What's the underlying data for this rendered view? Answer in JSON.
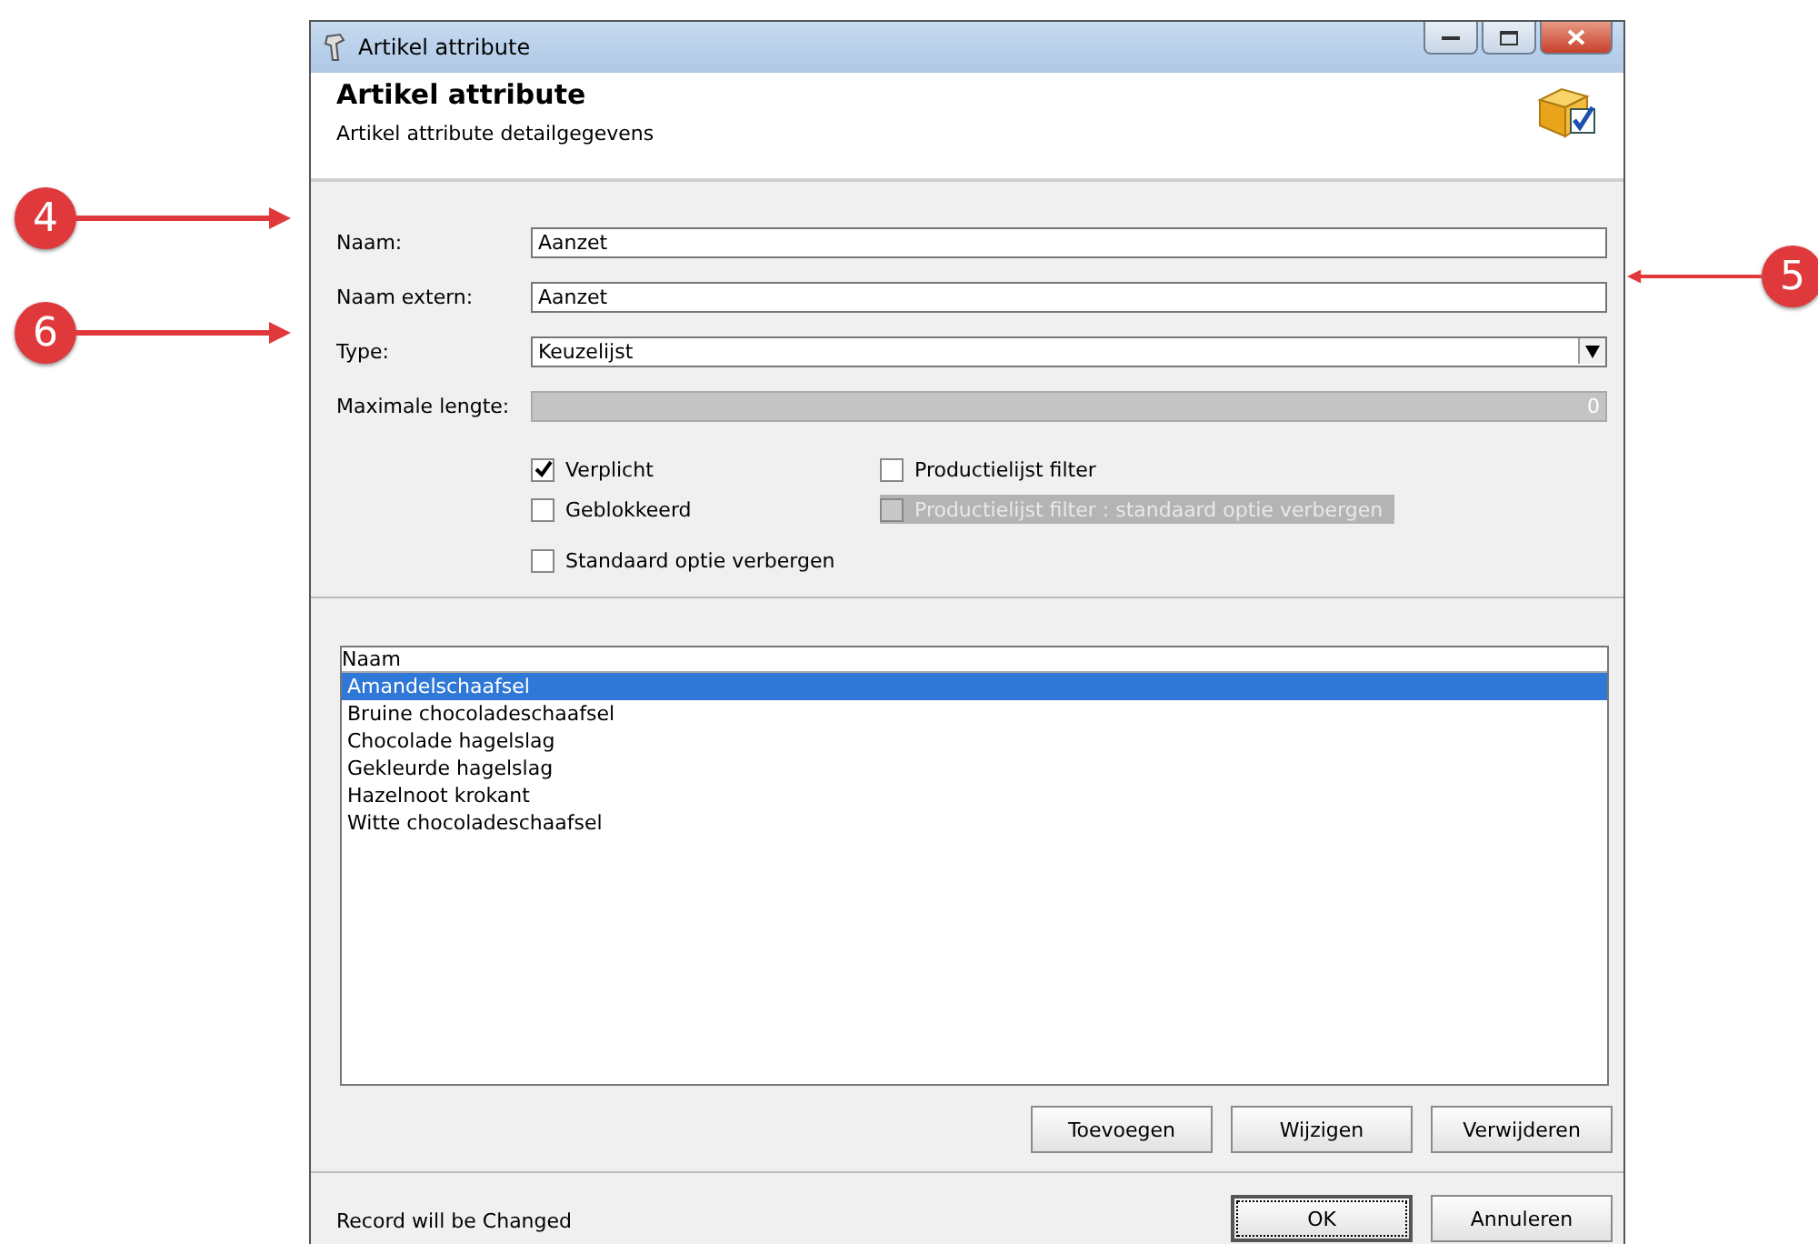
{
  "window": {
    "title": "Artikel attribute"
  },
  "header": {
    "title": "Artikel attribute",
    "subtitle": "Artikel attribute detailgegevens"
  },
  "fields": [
    {
      "kind": "text",
      "label": "Naam:",
      "value": "Aanzet",
      "disabled": false
    },
    {
      "kind": "text",
      "label": "Naam extern:",
      "value": "Aanzet",
      "disabled": false
    },
    {
      "kind": "select",
      "label": "Type:",
      "value": "Keuzelijst",
      "disabled": false
    },
    {
      "kind": "number",
      "label": "Maximale lengte:",
      "value": "0",
      "disabled": true
    }
  ],
  "checkbox_columns": [
    [
      {
        "label": "Verplicht",
        "checked": true,
        "disabled": false
      },
      {
        "label": "Geblokkeerd",
        "checked": false,
        "disabled": false
      },
      {
        "label": "Standaard optie verbergen",
        "checked": false,
        "disabled": false
      }
    ],
    [
      {
        "label": "Productielijst filter",
        "checked": false,
        "disabled": false
      },
      {
        "label": "Productielijst filter : standaard optie verbergen",
        "checked": false,
        "disabled": true
      }
    ]
  ],
  "list": {
    "column": "Naam",
    "rows": [
      {
        "label": "Amandelschaafsel",
        "selected": true
      },
      {
        "label": "Bruine chocoladeschaafsel",
        "selected": false
      },
      {
        "label": "Chocolade hagelslag",
        "selected": false
      },
      {
        "label": "Gekleurde hagelslag",
        "selected": false
      },
      {
        "label": "Hazelnoot krokant",
        "selected": false
      },
      {
        "label": "Witte chocoladeschaafsel",
        "selected": false
      }
    ]
  },
  "list_buttons": [
    "Toevoegen",
    "Wijzigen",
    "Verwijderen"
  ],
  "status": "Record will be Changed",
  "dialog_buttons": [
    {
      "label": "OK",
      "default": true
    },
    {
      "label": "Annuleren",
      "default": false
    }
  ],
  "callouts": [
    "4",
    "5",
    "6"
  ]
}
